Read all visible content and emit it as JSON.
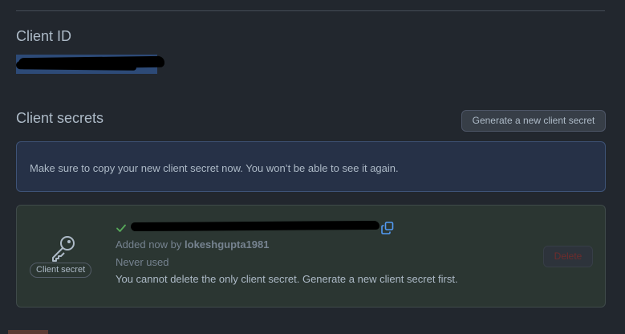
{
  "client_id": {
    "heading": "Client ID",
    "value": ""
  },
  "client_secrets": {
    "heading": "Client secrets",
    "generate_button_label": "Generate a new client secret"
  },
  "flash": {
    "message": "Make sure to copy your new client secret now. You won’t be able to see it again."
  },
  "secret": {
    "label": "Client secret",
    "value": "",
    "added_prefix": "Added now by ",
    "added_by": "lokeshgupta1981",
    "usage": "Never used",
    "delete_note": "You cannot delete the only client secret. Generate a new client secret first.",
    "delete_label": "Delete",
    "delete_disabled": true
  },
  "colors": {
    "background": "#22272e",
    "flash_background": "#263147",
    "secret_card_background": "#2b3632",
    "success_check": "#57ab5a",
    "copy_icon": "#539bf5",
    "danger_disabled": "#6e2c2c"
  },
  "icons": [
    "key-icon",
    "check-icon",
    "copy-icon"
  ]
}
